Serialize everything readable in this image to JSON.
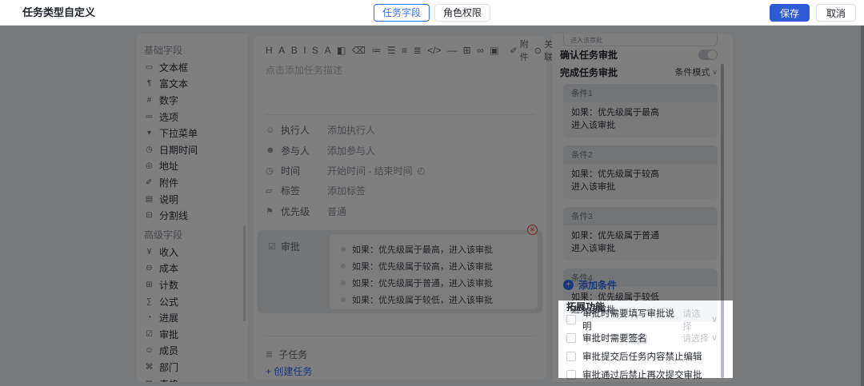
{
  "colors": {
    "accent": "#3370ff",
    "primary_button": "#2e5bd6",
    "danger": "#f54a45",
    "overlay": "rgba(0,0,0,0.5)"
  },
  "header": {
    "title": "任务类型自定义",
    "tabs": [
      {
        "label": "任务字段",
        "active": true
      },
      {
        "label": "角色权限",
        "active": false
      }
    ],
    "save_label": "保存",
    "cancel_label": "取消"
  },
  "fields_panel": {
    "basic_title": "基础字段",
    "basic_items": [
      {
        "icon": "▭",
        "label": "文本框"
      },
      {
        "icon": "¶",
        "label": "富文本"
      },
      {
        "icon": "#",
        "label": "数字"
      },
      {
        "icon": "≔",
        "label": "选项"
      },
      {
        "icon": "▾",
        "label": "下拉菜单"
      },
      {
        "icon": "◷",
        "label": "日期时间"
      },
      {
        "icon": "◎",
        "label": "地址"
      },
      {
        "icon": "✐",
        "label": "附件"
      },
      {
        "icon": "▤",
        "label": "说明"
      },
      {
        "icon": "⊟",
        "label": "分割线"
      }
    ],
    "advanced_title": "高级字段",
    "advanced_items": [
      {
        "icon": "¥",
        "label": "收入"
      },
      {
        "icon": "⊖",
        "label": "成本"
      },
      {
        "icon": "⊞",
        "label": "计数"
      },
      {
        "icon": "∑",
        "label": "公式"
      },
      {
        "icon": "◔",
        "label": "进展"
      },
      {
        "icon": "☑",
        "label": "审批"
      },
      {
        "icon": "☺",
        "label": "成员"
      },
      {
        "icon": "⌘",
        "label": "部门"
      },
      {
        "icon": "▦",
        "label": "表格"
      }
    ]
  },
  "editor": {
    "toolbar_icons": [
      "H",
      "A",
      "B",
      "I",
      "S",
      "A",
      "◧",
      "⌫",
      "≔",
      "☰",
      "≡",
      "≣",
      "</>",
      "—",
      "⊞",
      "∞",
      "▣"
    ],
    "attach_icon": "✐",
    "attach_label": "附件",
    "relate_icon": "⊙",
    "relate_label": "关联",
    "placeholder": "点击添加任务描述",
    "rows": [
      {
        "icon": "☺",
        "label": "执行人",
        "value": "添加执行人"
      },
      {
        "icon": "☻",
        "label": "参与人",
        "value": "添加参与人"
      },
      {
        "icon": "◷",
        "label": "时间",
        "value": "开始时间 - 结束时间",
        "suffix_icon": "◴"
      },
      {
        "icon": "▱",
        "label": "标签",
        "value": "添加标签"
      },
      {
        "icon": "⚑",
        "label": "优先级",
        "value": "普通"
      }
    ],
    "approval_block": {
      "icon": "☑",
      "label": "审批",
      "close_icon": "✕",
      "rules": [
        "如果：优先级属于最高，进入该审批",
        "如果：优先级属于较高，进入该审批",
        "如果：优先级属于普通，进入该审批",
        "如果：优先级属于较低，进入该审批"
      ]
    },
    "subtask_icon": "≣",
    "subtask_label": "子任务",
    "create_task_label": "+ 创建任务"
  },
  "settings_panel": {
    "partial_top_text": "进入该审批",
    "confirm_approval_label": "确认任务审批",
    "complete_approval_label": "完成任务审批",
    "mode_label": "条件模式",
    "mode_caret": "∨",
    "conditions": [
      {
        "title": "条件1",
        "line1": "如果：优先级属于最高",
        "line2": "进入该审批"
      },
      {
        "title": "条件2",
        "line1": "如果：优先级属于较高",
        "line2": "进入该审批"
      },
      {
        "title": "条件3",
        "line1": "如果：优先级属于普通",
        "line2": "进入该审批"
      },
      {
        "title": "条件4",
        "line1": "如果：优先级属于较低",
        "line2": "进入该审批"
      }
    ],
    "add_condition_plus": "+",
    "add_condition_label": "添加条件",
    "extended": {
      "title": "拓展功能",
      "options": [
        {
          "prefix": "审批时需要填写审批说明",
          "highlight": "",
          "select": "请选择",
          "caret": "∨"
        },
        {
          "prefix": "审批时需要",
          "highlight": "签名",
          "select": "请选择",
          "caret": "∨"
        },
        {
          "prefix": "审批提交后任务内容禁止编辑",
          "highlight": ""
        },
        {
          "prefix": "审批通过后禁止再次提交审批",
          "highlight": ""
        }
      ]
    }
  }
}
